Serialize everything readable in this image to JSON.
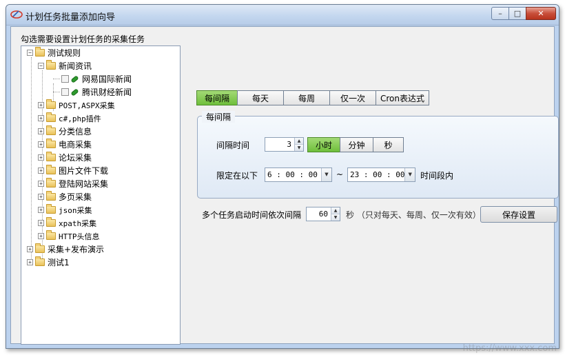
{
  "window": {
    "title": "计划任务批量添加向导",
    "min_glyph": "–",
    "max_glyph": "□",
    "close_glyph": "✕"
  },
  "left_panel": {
    "label": "勾选需要设置计划任务的采集任务",
    "tree": {
      "root": "测试规则",
      "news_group": "新闻资讯",
      "news_items": [
        "网易国际新闻",
        "腾讯财经新闻"
      ],
      "groups": [
        "POST,ASPX采集",
        "c#,php插件",
        "分类信息",
        "电商采集",
        "论坛采集",
        "图片文件下载",
        "登陆网站采集",
        "多页采集",
        "json采集",
        "xpath采集",
        "HTTP头信息"
      ],
      "top_others": [
        "采集+发布演示",
        "测试1"
      ],
      "expanded_glyph": "−",
      "collapsed_glyph": "+"
    }
  },
  "tabs": [
    "每间隔",
    "每天",
    "每周",
    "仅一次",
    "Cron表达式"
  ],
  "interval_group": {
    "title": "每间隔",
    "interval_label": "间隔时间",
    "interval_value": "3",
    "units": [
      "小时",
      "分钟",
      "秒"
    ],
    "range_label": "限定在以下",
    "start_time": "6 : 00 : 00",
    "tilde": "~",
    "end_time": "23 : 00 : 00",
    "range_suffix": "时间段内"
  },
  "stagger": {
    "label": "多个任务启动时间依次间隔",
    "value": "60",
    "suffix": "秒 （只对每天、每周、仅一次有效）"
  },
  "save_button": "保存设置",
  "watermark": "https://www.xxx.com",
  "colors": {
    "active_green": "#7cc646",
    "window_blue": "#bcd2ee"
  }
}
